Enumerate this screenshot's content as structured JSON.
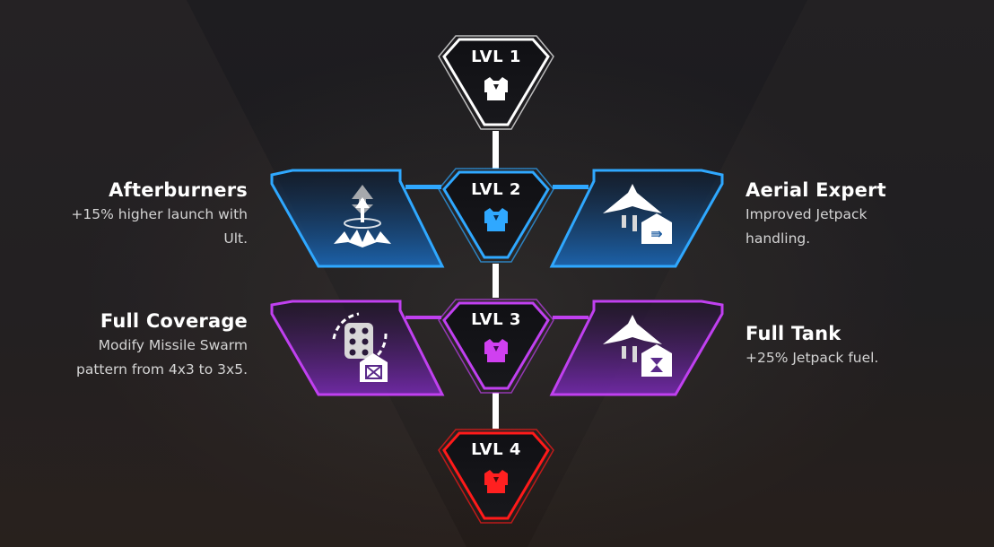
{
  "levels": [
    {
      "label": "LVL 1",
      "color": "#ffffff"
    },
    {
      "label": "LVL 2",
      "color": "#2fa8ff"
    },
    {
      "label": "LVL 3",
      "color": "#c040f0"
    },
    {
      "label": "LVL 4",
      "color": "#ff1a1a"
    }
  ],
  "perks": {
    "afterburners": {
      "name": "Afterburners",
      "desc_line1": "+15% higher launch with",
      "desc_line2": "Ult."
    },
    "aerial_expert": {
      "name": "Aerial Expert",
      "desc_line1": "Improved Jetpack",
      "desc_line2": "handling."
    },
    "full_coverage": {
      "name": "Full Coverage",
      "desc_line1": "Modify Missile Swarm",
      "desc_line2": "pattern from 4x3 to 3x5."
    },
    "full_tank": {
      "name": "Full Tank",
      "desc_line1": "+25% Jetpack fuel."
    }
  },
  "icons": {
    "armor": "body-armor-icon",
    "afterburners": "upward-launch-burst-icon",
    "aerial_expert": "jet-with-arrow-badge-icon",
    "full_coverage": "missile-pod-rotate-icon",
    "full_tank": "jet-with-hourglass-badge-icon"
  }
}
